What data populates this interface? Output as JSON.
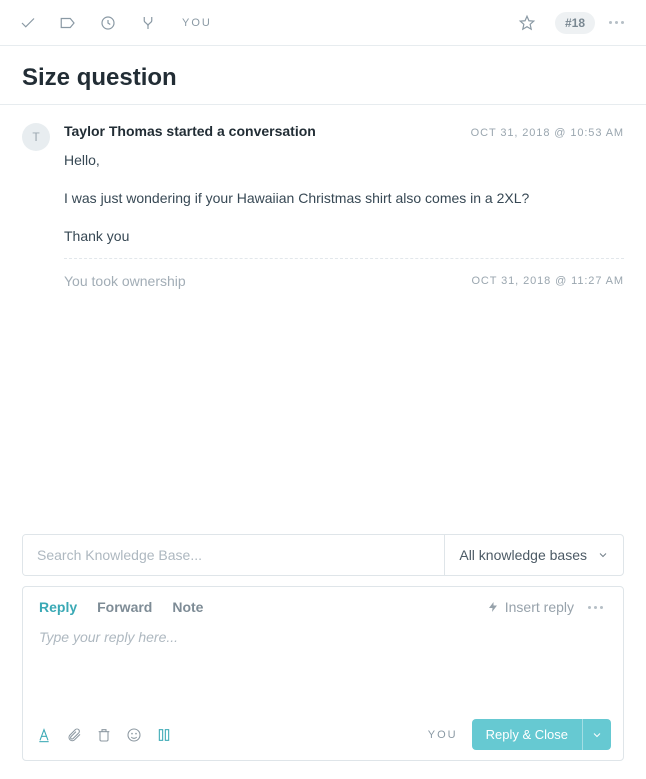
{
  "toolbar": {
    "assigned_label": "YOU",
    "ticket_id": "#18"
  },
  "conversation": {
    "title": "Size question"
  },
  "message": {
    "avatar_initial": "T",
    "author_line": "Taylor Thomas started a conversation",
    "timestamp": "OCT 31, 2018 @ 10:53 AM",
    "p1": "Hello,",
    "p2": "I was just wondering if your Hawaiian Christmas shirt also comes in a 2XL?",
    "p3": "Thank you"
  },
  "system_event": {
    "text": "You took ownership",
    "timestamp": "OCT 31, 2018 @ 11:27 AM"
  },
  "kb": {
    "search_placeholder": "Search Knowledge Base...",
    "scope_label": "All knowledge bases"
  },
  "reply": {
    "tabs": {
      "reply": "Reply",
      "forward": "Forward",
      "note": "Note"
    },
    "insert_reply": "Insert reply",
    "placeholder": "Type your reply here...",
    "footer_you": "YOU",
    "send_label": "Reply & Close"
  }
}
